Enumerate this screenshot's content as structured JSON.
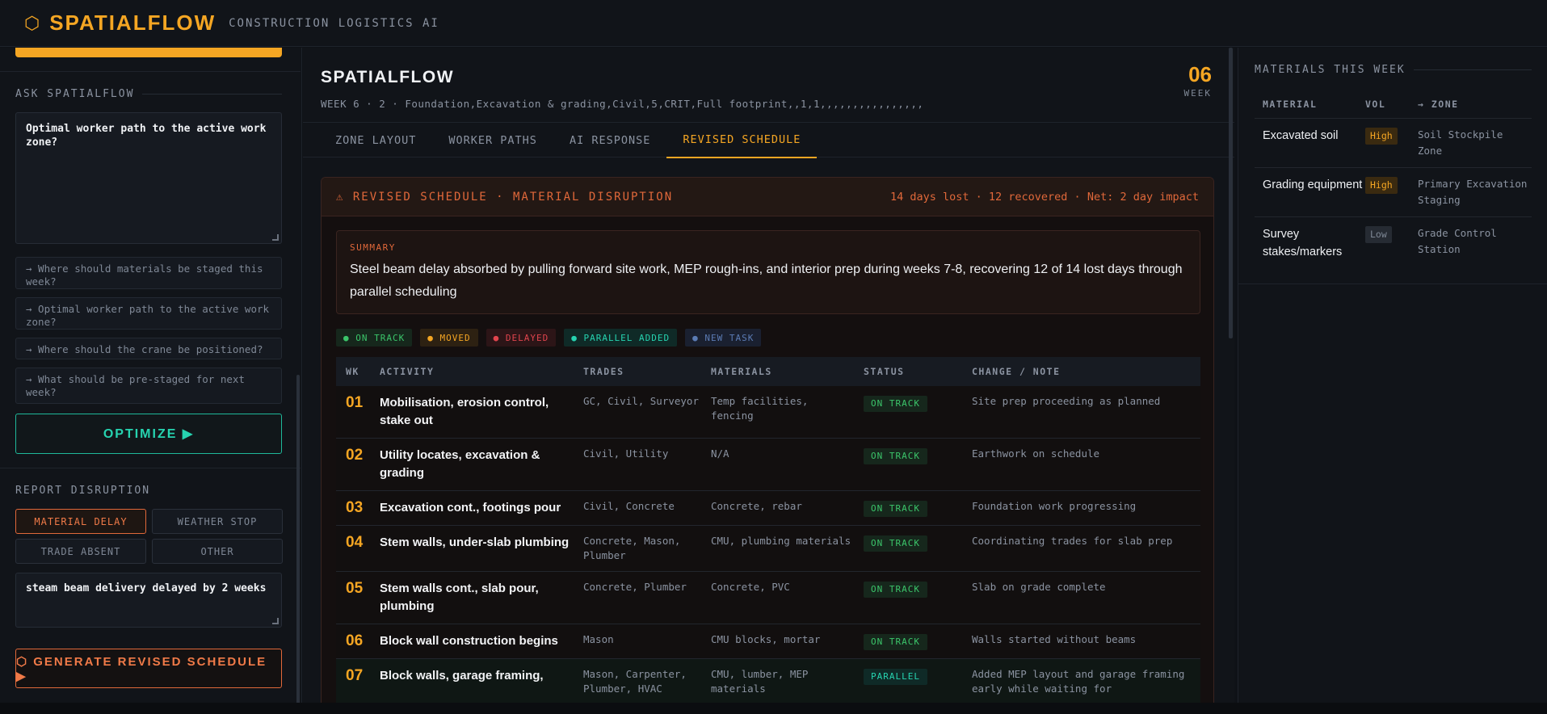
{
  "app": {
    "logo_icon": "⬡",
    "name": "SPATIALFLOW",
    "subtitle": "CONSTRUCTION LOGISTICS AI"
  },
  "left": {
    "ask_label": "ASK SPATIALFLOW",
    "ask_value": "Optimal worker path to the active work zone?",
    "suggestions": [
      "→ Where should materials be staged this week?",
      "→ Optimal worker path to the active work zone?",
      "→ Where should the crane be positioned?",
      "→ What should be pre-staged for next week?"
    ],
    "optimize_label": "OPTIMIZE ▶",
    "report_label": "REPORT DISRUPTION",
    "disruption_types": [
      "MATERIAL DELAY",
      "WEATHER STOP",
      "TRADE ABSENT",
      "OTHER"
    ],
    "disruption_value": "steam beam delivery delayed by 2 weeks",
    "generate_label": "⬡ GENERATE REVISED SCHEDULE ▶"
  },
  "center": {
    "title": "SPATIALFLOW",
    "subtitle": "WEEK 6 · 2 · Foundation,Excavation & grading,Civil,5,CRIT,Full footprint,,1,1,,,,,,,,,,,,,,,,",
    "week_num": "06",
    "week_label": "WEEK",
    "tabs": [
      "ZONE LAYOUT",
      "WORKER PATHS",
      "AI RESPONSE",
      "REVISED SCHEDULE"
    ],
    "disruption": {
      "title": "⚠ REVISED SCHEDULE · MATERIAL DISRUPTION",
      "impact": "14 days lost · 12 recovered · Net: 2 day impact",
      "summary_label": "SUMMARY",
      "summary": "Steel beam delay absorbed by pulling forward site work, MEP rough-ins, and interior prep during weeks 7-8, recovering 12 of 14 lost days through parallel scheduling",
      "legend": [
        "● ON TRACK",
        "● MOVED",
        "● DELAYED",
        "● PARALLEL ADDED",
        "● NEW TASK"
      ]
    },
    "table": {
      "headers": [
        "WK",
        "ACTIVITY",
        "TRADES",
        "MATERIALS",
        "STATUS",
        "CHANGE / NOTE"
      ],
      "rows": [
        {
          "wk": "01",
          "activity": "Mobilisation, erosion control, stake out",
          "trades": "GC, Civil, Surveyor",
          "materials": "Temp facilities, fencing",
          "status": "ON TRACK",
          "note": "Site prep proceeding as planned"
        },
        {
          "wk": "02",
          "activity": "Utility locates, excavation & grading",
          "trades": "Civil, Utility",
          "materials": "N/A",
          "status": "ON TRACK",
          "note": "Earthwork on schedule"
        },
        {
          "wk": "03",
          "activity": "Excavation cont., footings pour",
          "trades": "Civil, Concrete",
          "materials": "Concrete, rebar",
          "status": "ON TRACK",
          "note": "Foundation work progressing"
        },
        {
          "wk": "04",
          "activity": "Stem walls, under-slab plumbing",
          "trades": "Concrete, Mason, Plumber",
          "materials": "CMU, plumbing materials",
          "status": "ON TRACK",
          "note": "Coordinating trades for slab prep"
        },
        {
          "wk": "05",
          "activity": "Stem walls cont., slab pour, plumbing",
          "trades": "Concrete, Plumber",
          "materials": "Concrete, PVC",
          "status": "ON TRACK",
          "note": "Slab on grade complete"
        },
        {
          "wk": "06",
          "activity": "Block wall construction begins",
          "trades": "Mason",
          "materials": "CMU blocks, mortar",
          "status": "ON TRACK",
          "note": "Walls started without beams"
        },
        {
          "wk": "07",
          "activity": "Block walls, garage framing,",
          "trades": "Mason, Carpenter, Plumber, HVAC",
          "materials": "CMU, lumber, MEP materials",
          "status": "PARALLEL",
          "note": "Added MEP layout and garage framing early while waiting for"
        }
      ]
    }
  },
  "right": {
    "label": "MATERIALS THIS WEEK",
    "headers": [
      "MATERIAL",
      "VOL",
      "→ ZONE"
    ],
    "rows": [
      {
        "material": "Excavated soil",
        "vol": "High",
        "zone": "Soil Stockpile Zone"
      },
      {
        "material": "Grading equipment",
        "vol": "High",
        "zone": "Primary Excavation Staging"
      },
      {
        "material": "Survey stakes/markers",
        "vol": "Low",
        "zone": "Grade Control Station"
      }
    ]
  }
}
